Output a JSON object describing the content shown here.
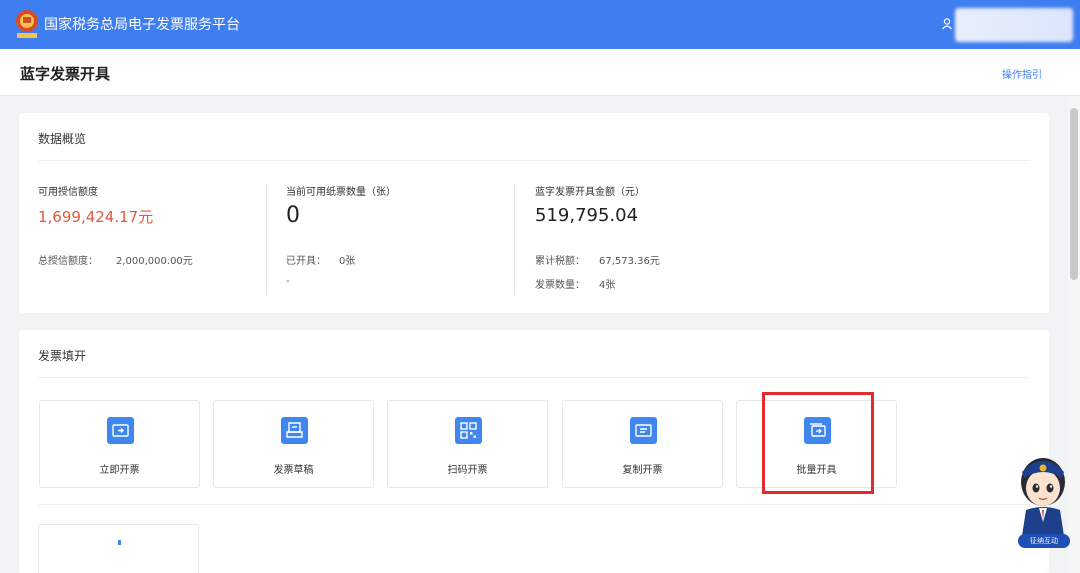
{
  "header": {
    "app_title": "国家税务总局电子发票服务平台",
    "logo_icon": "tax-bureau-emblem-icon",
    "user_icon": "user-icon",
    "brand_color": "#3f7ef0"
  },
  "page": {
    "title": "蓝字发票开具",
    "guide_link": "操作指引"
  },
  "overview": {
    "title": "数据概览",
    "credit": {
      "label": "可用授信额度",
      "value": "1,699,424.17元",
      "total_label": "总授信额度：",
      "total_value": "2,000,000.00元"
    },
    "paper": {
      "label": "当前可用纸票数量（张）",
      "value": "0",
      "issued_label": "已开具：",
      "issued_value": "0张",
      "dash": "-"
    },
    "blue_invoice": {
      "label": "蓝字发票开具金额（元）",
      "value": "519,795.04",
      "tax_label": "累计税额：",
      "tax_value": "67,573.36元",
      "count_label": "发票数量：",
      "count_value": "4张"
    }
  },
  "fill": {
    "title": "发票填开",
    "tiles": [
      {
        "label": "立即开票",
        "icon": "ticket-issue-icon"
      },
      {
        "label": "发票草稿",
        "icon": "draft-document-icon"
      },
      {
        "label": "扫码开票",
        "icon": "qr-code-icon"
      },
      {
        "label": "复制开票",
        "icon": "copy-ticket-icon"
      },
      {
        "label": "批量开具",
        "icon": "batch-issue-icon"
      }
    ],
    "highlight_color": "#e32b2e"
  },
  "assistant": {
    "badge": "征纳互动",
    "icon": "tax-assistant-mascot-icon"
  }
}
